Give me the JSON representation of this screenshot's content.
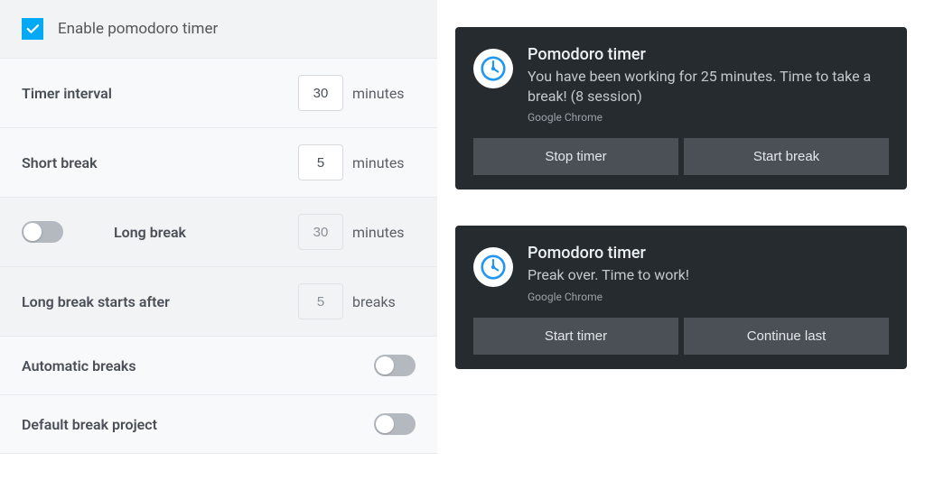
{
  "settings": {
    "enable_label": "Enable pomodoro timer",
    "enable_checked": true,
    "timer_interval_label": "Timer interval",
    "timer_interval_value": "30",
    "timer_interval_unit": "minutes",
    "short_break_label": "Short break",
    "short_break_value": "5",
    "short_break_unit": "minutes",
    "long_break_label": "Long break",
    "long_break_value": "30",
    "long_break_unit": "minutes",
    "long_break_enabled": false,
    "long_break_after_label": "Long break starts after",
    "long_break_after_value": "5",
    "long_break_after_unit": "breaks",
    "automatic_breaks_label": "Automatic breaks",
    "automatic_breaks_on": false,
    "default_break_project_label": "Default break project",
    "default_break_project_on": false
  },
  "notifications": [
    {
      "title": "Pomodoro timer",
      "body": "You have been working for 25 minutes. Time to take a break! (8 session)",
      "source": "Google Chrome",
      "btn1": "Stop timer",
      "btn2": "Start break"
    },
    {
      "title": "Pomodoro timer",
      "body": "Preak over. Time to work!",
      "source": "Google Chrome",
      "btn1": "Start timer",
      "btn2": "Continue last"
    }
  ]
}
